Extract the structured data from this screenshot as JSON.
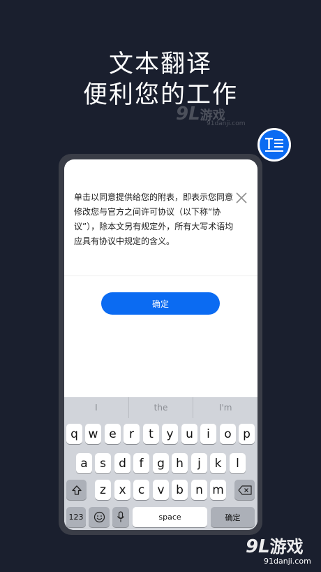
{
  "headline": {
    "line1": "文本翻译",
    "line2": "便利您的工作"
  },
  "watermark_top": {
    "mark": "9L",
    "cn": "游戏",
    "url": "91danji.com"
  },
  "dialog": {
    "message": "单击以同意提供给您的附表，即表示您同意修改您与官方之间许可协议（以下称“协议”），除本文另有规定外，所有大写术语均应具有协议中规定的含义。",
    "confirm_label": "确定"
  },
  "keyboard": {
    "suggestions": [
      "I",
      "the",
      "I'm"
    ],
    "row1": [
      "q",
      "w",
      "e",
      "r",
      "t",
      "y",
      "u",
      "i",
      "o",
      "p"
    ],
    "row2": [
      "a",
      "s",
      "d",
      "f",
      "g",
      "h",
      "j",
      "k",
      "l"
    ],
    "row3": [
      "z",
      "x",
      "c",
      "v",
      "b",
      "n",
      "m"
    ],
    "numbers_label": "123",
    "space_label": "space",
    "return_label": "确定"
  },
  "watermark_bottom": {
    "mark": "9L",
    "cn": "游戏",
    "url": "91danji.com"
  },
  "colors": {
    "accent": "#0b6bf2",
    "background": "#1a1f2e",
    "keyboard": "#d1d4da"
  }
}
